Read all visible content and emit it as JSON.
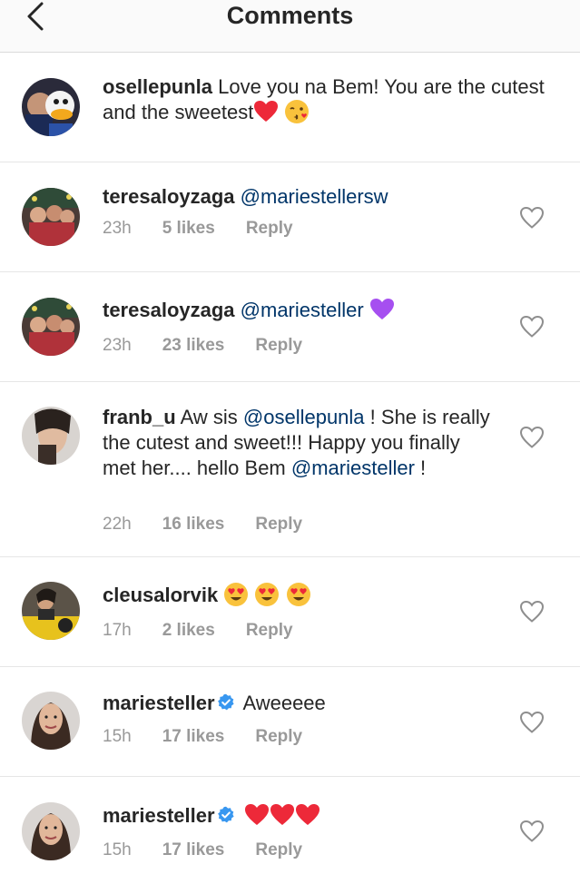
{
  "header": {
    "title": "Comments"
  },
  "colors": {
    "mention": "#003569",
    "meta": "#999999",
    "heart_red": "#ed2939",
    "purple_heart": "#a64ff0",
    "verified_blue": "#3897f0"
  },
  "caption": {
    "username": "osellepunla",
    "text": "Love you na Bem! You are the cutest and the sweetest"
  },
  "comments": [
    {
      "username": "teresaloyzaga",
      "mention": "@mariestellersw",
      "time": "23h",
      "likes": "5 likes",
      "reply": "Reply"
    },
    {
      "username": "teresaloyzaga",
      "mention": "@mariesteller",
      "time": "23h",
      "likes": "23 likes",
      "reply": "Reply"
    },
    {
      "username": "franb_u",
      "text_before": "Aw sis",
      "mention": "@osellepunla",
      "text_mid": "!  She is really the cutest and sweet!!! Happy you finally met her.... hello Bem",
      "mention2": "@mariesteller",
      "text_after": "!",
      "time": "22h",
      "likes": "16 likes",
      "reply": "Reply"
    },
    {
      "username": "cleusalorvik",
      "time": "17h",
      "likes": "2 likes",
      "reply": "Reply"
    },
    {
      "username": "mariesteller",
      "text": "Aweeeee",
      "time": "15h",
      "likes": "17 likes",
      "reply": "Reply"
    },
    {
      "username": "mariesteller",
      "time": "15h",
      "likes": "17 likes",
      "reply": "Reply"
    }
  ],
  "icons": {
    "back": "chevron-left-icon",
    "like": "heart-outline-icon",
    "verified": "verified-badge-icon"
  }
}
